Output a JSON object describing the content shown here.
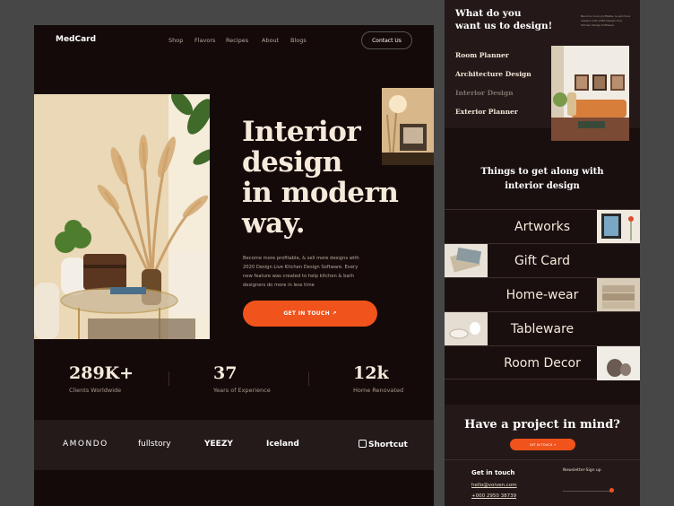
{
  "nav": {
    "logo": "MedCard",
    "links": [
      "Shop",
      "Flavors",
      "Recipes",
      "About",
      "Blogs"
    ],
    "contact": "Contact Us"
  },
  "hero": {
    "title": "Interior design in modern way.",
    "title_lines": [
      "Interior",
      "design",
      "in modern",
      "way."
    ],
    "desc": "Become more profitable, & sell more designs with 2020 Design Live Kitchen Design Software. Every new feature was created to help kitchen & bath designers do more in less time",
    "cta": "GET IN TOUCH ↗"
  },
  "stats": [
    {
      "num": "289K+",
      "label": "Clients Worldwide"
    },
    {
      "num": "37",
      "label": "Years of Experience"
    },
    {
      "num": "12k",
      "label": "Home Renovated"
    }
  ],
  "brands": [
    "AMONDO",
    "fullstory",
    "YEEZY",
    "Iceland",
    "Shortcut"
  ],
  "side": {
    "heading_lines": [
      "What do you",
      "want us to design!"
    ],
    "intro": "Become more profitable, & sell more designs with 2020 Design Live Kitchen Design Software.",
    "services": [
      "Room Planner",
      "Architecture Design",
      "Interior Design",
      "Exterior Planner"
    ],
    "things_title_lines": [
      "Things to get along with",
      "interior design"
    ],
    "things": [
      "Artworks",
      "Gift Card",
      "Home-wear",
      "Tableware",
      "Room Decor"
    ],
    "project_title": "Have a project in mind?",
    "project_cta": "GET IN TOUCH ↗",
    "get_in_touch": "Get in touch",
    "email": "hello@voiven.com",
    "phone": "+000 2950 38739",
    "newsletter": "Newsletter-Sign up"
  },
  "colors": {
    "accent": "#f0531c",
    "bg": "#150a0a",
    "text": "#f6eadb"
  }
}
